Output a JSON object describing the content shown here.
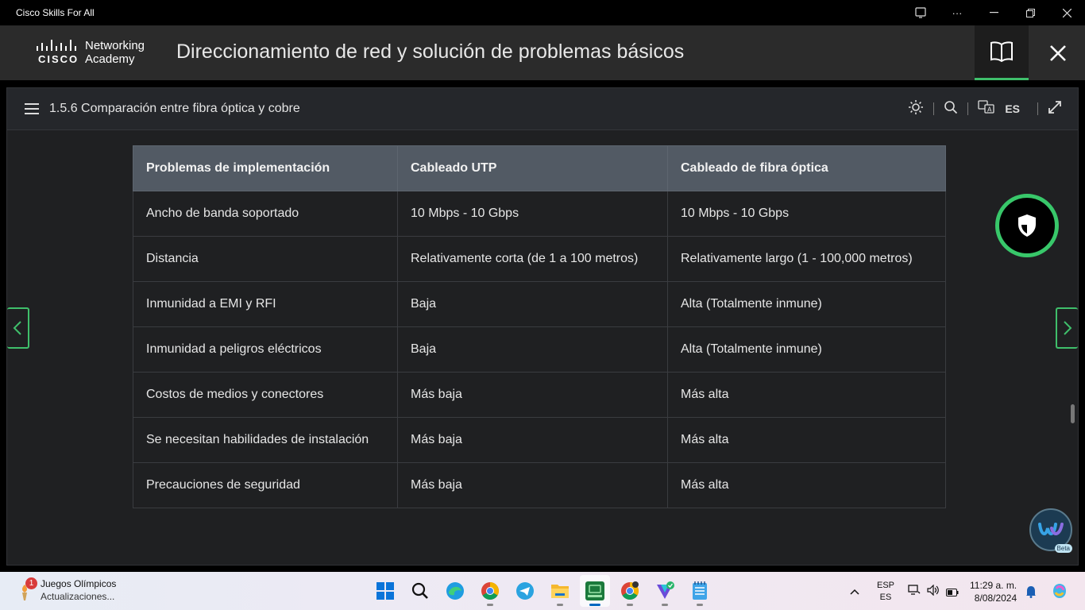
{
  "window": {
    "title": "Cisco Skills For All"
  },
  "header": {
    "logo_brand": "cisco",
    "logo_line1": "Networking",
    "logo_line2": "Academy",
    "course_title": "Direccionamiento de red y solución de problemas básicos"
  },
  "toolbar": {
    "section_title": "1.5.6 Comparación entre fibra óptica y cobre",
    "language": "ES"
  },
  "table": {
    "headers": [
      "Problemas de implementación",
      "Cableado UTP",
      "Cableado de fibra óptica"
    ],
    "rows": [
      [
        "Ancho de banda soportado",
        "10 Mbps - 10 Gbps",
        "10 Mbps - 10 Gbps"
      ],
      [
        "Distancia",
        "Relativamente corta (de 1 a 100 metros)",
        "Relativamente largo (1 - 100,000 metros)"
      ],
      [
        "Inmunidad a EMI y RFI",
        "Baja",
        "Alta (Totalmente inmune)"
      ],
      [
        "Inmunidad a peligros eléctricos",
        "Baja",
        "Alta (Totalmente inmune)"
      ],
      [
        "Costos de medios y conectores",
        "Más baja",
        "Más alta"
      ],
      [
        "Se necesitan habilidades de instalación",
        "Más baja",
        "Más alta"
      ],
      [
        "Precauciones de seguridad",
        "Más baja",
        "Más alta"
      ]
    ]
  },
  "webex": {
    "badge": "Beta"
  },
  "taskbar": {
    "weather_badge": "1",
    "weather_title": "Juegos Olímpicos",
    "weather_subtitle": "Actualizaciones...",
    "input_lang": "ESP",
    "input_layout": "ES",
    "time": "11:29 a. m.",
    "date": "8/08/2024"
  },
  "colors": {
    "accent": "#3fbf6b",
    "header_bg": "#2b2b2b",
    "table_header_bg": "#525a64"
  }
}
